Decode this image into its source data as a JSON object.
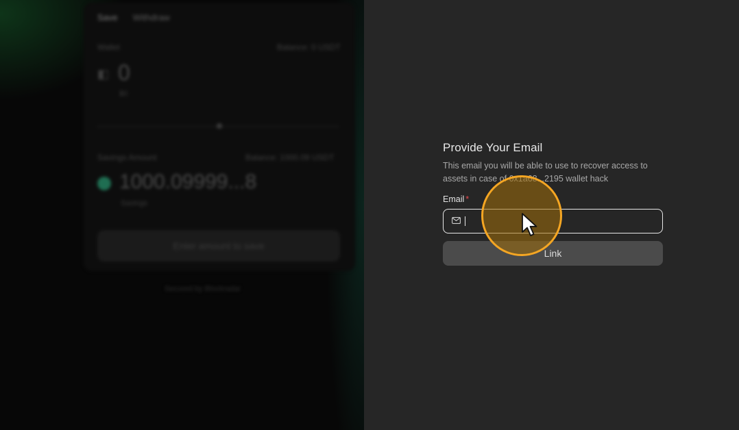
{
  "background_app": {
    "tabs": [
      "Save",
      "Withdraw"
    ],
    "wallet_label": "Wallet",
    "balance_top": "Balance: 0 USDT",
    "amount": "0",
    "amount_sub": "$0",
    "savings_label": "Savings Amount",
    "balance_savings": "Balance: 1000.09 USDT",
    "savings_amount": "1000.09999...8",
    "savings_sub": "Savings",
    "action_button": "Enter amount to save",
    "secured_by": "Secured by Blockradar"
  },
  "modal": {
    "title": "Provide Your Email",
    "description": "This email you will be able to use to recover access to assets in case of 0x1a68...2195 wallet hack",
    "email_label": "Email",
    "required_mark": "*",
    "email_value": "",
    "email_placeholder": "",
    "submit_label": "Link"
  },
  "colors": {
    "panel_bg": "#262626",
    "accent_highlight": "#f5a623",
    "required": "#e5484d",
    "button_bg": "#4b4b4b"
  },
  "icons": {
    "email_field_icon": "mail-icon",
    "pointer": "cursor-icon"
  }
}
